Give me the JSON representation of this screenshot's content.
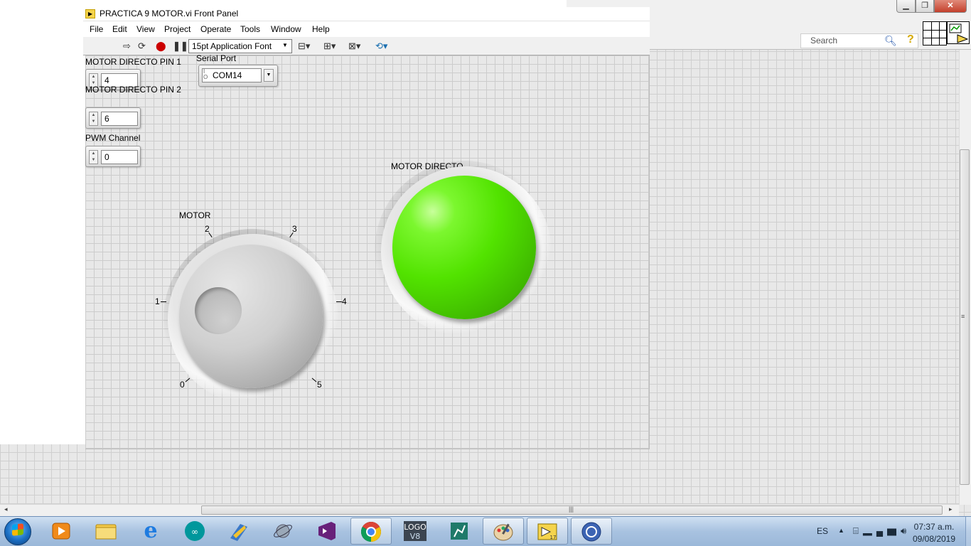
{
  "window": {
    "title": "PRACTICA 9 MOTOR.vi Front Panel",
    "menu": [
      "File",
      "Edit",
      "View",
      "Project",
      "Operate",
      "Tools",
      "Window",
      "Help"
    ],
    "toolbar": {
      "font_selector": "15pt Application Font",
      "icons": [
        "run-arrow",
        "run-continuous",
        "abort",
        "pause",
        "align-objects",
        "distribute-objects",
        "resize-objects",
        "reorder"
      ]
    }
  },
  "back_window": {
    "search_placeholder": "Search",
    "caption_buttons": {
      "minimize": "▁",
      "maximize": "❐",
      "close": "✕"
    }
  },
  "controls": {
    "motor_pin1": {
      "label": "MOTOR DIRECTO PIN 1",
      "value": "4"
    },
    "motor_pin2": {
      "label": "MOTOR  DIRECTO PIN 2",
      "value": "6"
    },
    "pwm_channel": {
      "label": "PWM Channel",
      "value": "0"
    },
    "serial_port": {
      "label": "Serial Port",
      "value": "COM14"
    },
    "motor_knob": {
      "label": "MOTOR",
      "ticks": [
        "0",
        "1",
        "2",
        "3",
        "4",
        "5"
      ]
    },
    "motor_led": {
      "label": "MOTOR DIRECTO",
      "state": "on",
      "color": "#52e300"
    }
  },
  "taskbar": {
    "apps": [
      "windows-media-player",
      "file-explorer",
      "internet-explorer",
      "arduino",
      "app-5",
      "app-6",
      "visual-studio",
      "chrome",
      "logo-v8",
      "app-10",
      "paint",
      "labview-17",
      "app-13"
    ],
    "active_apps": [
      "paint",
      "labview-17",
      "app-13"
    ],
    "language": "ES",
    "time": "07:37 a.m.",
    "date": "09/08/2019"
  }
}
